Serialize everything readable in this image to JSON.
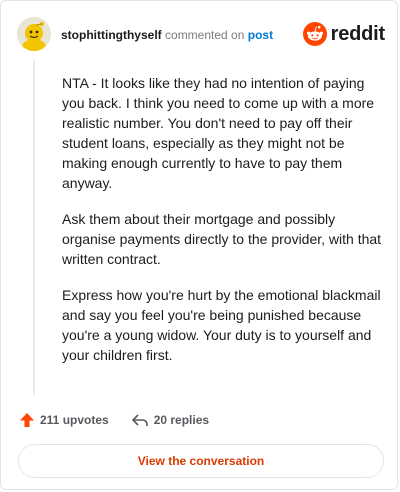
{
  "comment": {
    "username": "stophittingthyself",
    "action_text": "commented on",
    "post_link_text": "post",
    "paragraphs": [
      "NTA - It looks like they had no intention of paying you back. I think you need to come up with a more realistic number. You don't need to pay off their student loans, especially as they might not be making enough currently to have to pay them anyway.",
      "Ask them about their mortgage and possibly organise payments directly to the provider, with that written contract.",
      "Express how you're hurt by the emotional blackmail and say you feel you're being punished because you're a young widow. Your duty is to yourself and your children first."
    ]
  },
  "brand": {
    "name": "reddit",
    "icon": "reddit-logo-icon",
    "color": "#ff4500"
  },
  "stats": {
    "upvotes": "211 upvotes",
    "replies": "20 replies",
    "upvote_icon": "upvote-arrow-icon",
    "reply_icon": "reply-arrow-icon",
    "upvote_color": "#ff4500"
  },
  "cta": {
    "label": "View the conversation",
    "color": "#d93a00"
  },
  "avatar": {
    "icon": "snoo-avatar-icon"
  }
}
